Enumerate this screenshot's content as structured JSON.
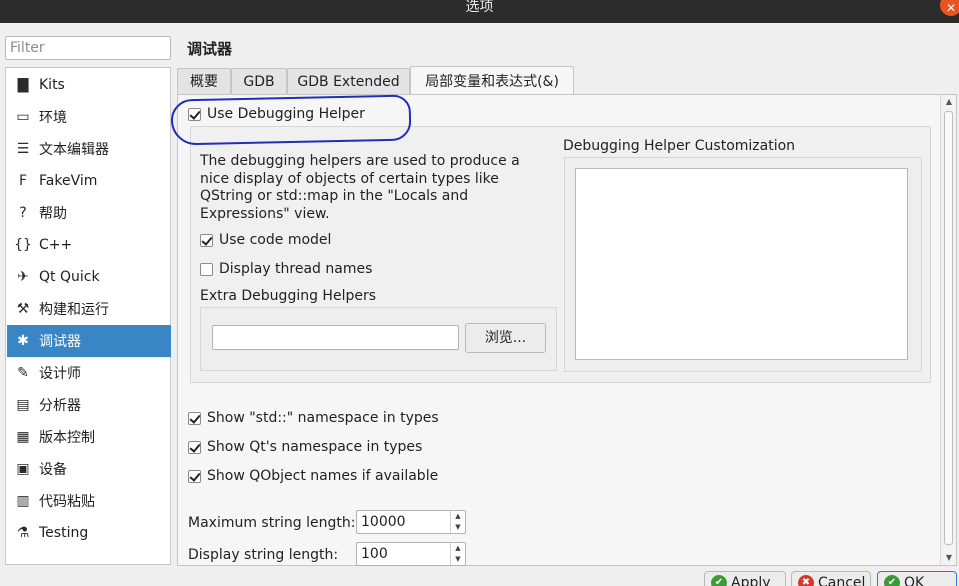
{
  "window": {
    "title": "选项",
    "close_glyph": "✕"
  },
  "filter": {
    "placeholder": "Filter"
  },
  "sidebar": {
    "items": [
      {
        "label": "Kits",
        "icon": "monitor-kit-icon",
        "glyph": "▇"
      },
      {
        "label": "环境",
        "icon": "monitor-icon",
        "glyph": "▭"
      },
      {
        "label": "文本编辑器",
        "icon": "text-editor-icon",
        "glyph": "☰"
      },
      {
        "label": "FakeVim",
        "icon": "fakevim-icon",
        "glyph": "F"
      },
      {
        "label": "帮助",
        "icon": "help-icon",
        "glyph": "?"
      },
      {
        "label": "C++",
        "icon": "braces-icon",
        "glyph": "{}"
      },
      {
        "label": "Qt Quick",
        "icon": "qtquick-icon",
        "glyph": "✈"
      },
      {
        "label": "构建和运行",
        "icon": "hammer-icon",
        "glyph": "⚒"
      },
      {
        "label": "调试器",
        "icon": "bug-icon",
        "glyph": "✱"
      },
      {
        "label": "设计师",
        "icon": "pencil-icon",
        "glyph": "✎"
      },
      {
        "label": "分析器",
        "icon": "analyzer-icon",
        "glyph": "▤"
      },
      {
        "label": "版本控制",
        "icon": "version-control-icon",
        "glyph": "▦"
      },
      {
        "label": "设备",
        "icon": "device-icon",
        "glyph": "▣"
      },
      {
        "label": "代码粘贴",
        "icon": "clipboard-icon",
        "glyph": "▥"
      },
      {
        "label": "Testing",
        "icon": "testing-icon",
        "glyph": "⚗"
      }
    ],
    "selected_index": 8
  },
  "main": {
    "section_title": "调试器",
    "tabs": [
      {
        "label": "概要"
      },
      {
        "label": "GDB"
      },
      {
        "label": "GDB Extended"
      },
      {
        "label": "局部变量和表达式(&)"
      }
    ],
    "active_tab": 3,
    "use_debugging_helper": {
      "label": "Use Debugging Helper",
      "checked": true
    },
    "description": "The debugging helpers are used to produce a nice display of objects of certain types like QString or std::map in the \"Locals and Expressions\" view.",
    "use_code_model": {
      "label": "Use code model",
      "checked": true
    },
    "display_thread_names": {
      "label": "Display thread names",
      "checked": false
    },
    "extra_helpers": {
      "label": "Extra Debugging Helpers",
      "value": "",
      "browse_label": "浏览..."
    },
    "customization": {
      "label": "Debugging Helper Customization",
      "value": ""
    },
    "show_std_namespace": {
      "label": "Show \"std::\" namespace in types",
      "checked": true
    },
    "show_qt_namespace": {
      "label": "Show Qt's namespace in types",
      "checked": true
    },
    "show_qobject_names": {
      "label": "Show QObject names if available",
      "checked": true
    },
    "max_string_length": {
      "label": "Maximum string length:",
      "value": "10000"
    },
    "display_string_length": {
      "label": "Display string length:",
      "value": "100"
    }
  },
  "footer": {
    "apply_label": "Apply",
    "cancel_label": "Cancel",
    "ok_label": "OK"
  },
  "colors": {
    "selection": "#3a86c4",
    "annotation": "#1f2fb8",
    "titlebar": "#2c2c2c"
  }
}
